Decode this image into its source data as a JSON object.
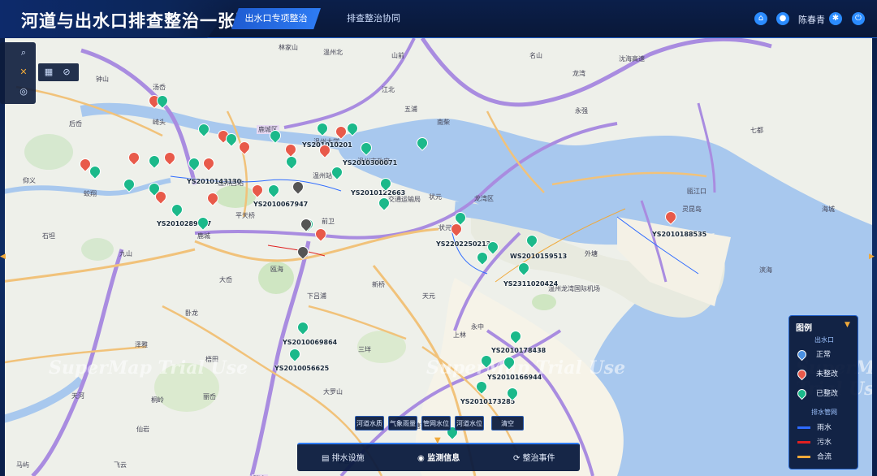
{
  "header": {
    "title": "河道与出水口排查整治一张图",
    "tabs": [
      {
        "label": "出水口专项整治",
        "active": true
      },
      {
        "label": "排查整治协同",
        "active": false
      }
    ],
    "user_name": "陈春青",
    "icons": [
      "home-icon",
      "user-icon",
      "settings-icon",
      "power-icon"
    ]
  },
  "toolbar": {
    "icons": [
      "search-icon",
      "measure-icon",
      "compass-icon",
      "layers-icon",
      "erase-icon"
    ]
  },
  "map": {
    "watermark": "SuperMap Trial Use",
    "place_labels": [
      "林家山",
      "温州北",
      "山前",
      "名山",
      "沈海高速",
      "龙湾",
      "钟山",
      "汤岙",
      "五浦",
      "江北",
      "后岙",
      "南柴",
      "永强",
      "崎头",
      "鹿城区",
      "温州市政府",
      "温州大学",
      "状元",
      "温州西站",
      "交通运输局",
      "龙湾区",
      "前卫",
      "仰义",
      "蛟翔",
      "平天桥",
      "温州站",
      "外塘",
      "鹿城",
      "九山",
      "大岙",
      "卧龙",
      "瓯海",
      "下吕浦",
      "新桥",
      "泽雅",
      "梧田",
      "三垟",
      "丽岙",
      "天河",
      "仙岩",
      "塘下",
      "瑞安",
      "莘塍",
      "飞云",
      "马屿",
      "温州龙湾国际机场",
      "瓯江口",
      "灵昆岛",
      "七都",
      "状元镇",
      "滨海",
      "海城",
      "桐岭",
      "大罗山",
      "永中",
      "天元",
      "上林",
      "石坦"
    ],
    "outfall_codes": [
      "YS201010201",
      "YS2010300071",
      "YS2010143130",
      "YS2010067947",
      "YS2010122663",
      "YS2010289567",
      "YS2010188535",
      "YS2202250213",
      "WS2010159513",
      "YS2311020424",
      "YS2010069864",
      "YS2010056625",
      "YS2010178438",
      "YS2010166944",
      "YS2010173285"
    ]
  },
  "legend": {
    "title": "图例",
    "outfall_section": "出水口",
    "outfall_items": [
      {
        "label": "正常",
        "color": "#4a90e2"
      },
      {
        "label": "未整改",
        "color": "#e85a4a"
      },
      {
        "label": "已整改",
        "color": "#1bb98a"
      }
    ],
    "pipe_section": "排水管网",
    "pipe_items": [
      {
        "label": "雨水",
        "color": "#2e6bff"
      },
      {
        "label": "污水",
        "color": "#e02020"
      },
      {
        "label": "合流",
        "color": "#f0a93a"
      }
    ]
  },
  "filters": [
    "河道水质",
    "气象雨量",
    "管网水位",
    "河道水位",
    "清空"
  ],
  "bottom_nav": [
    {
      "label": "排水设施",
      "active": false
    },
    {
      "label": "监测信息",
      "active": true
    },
    {
      "label": "整治事件",
      "active": false
    }
  ]
}
